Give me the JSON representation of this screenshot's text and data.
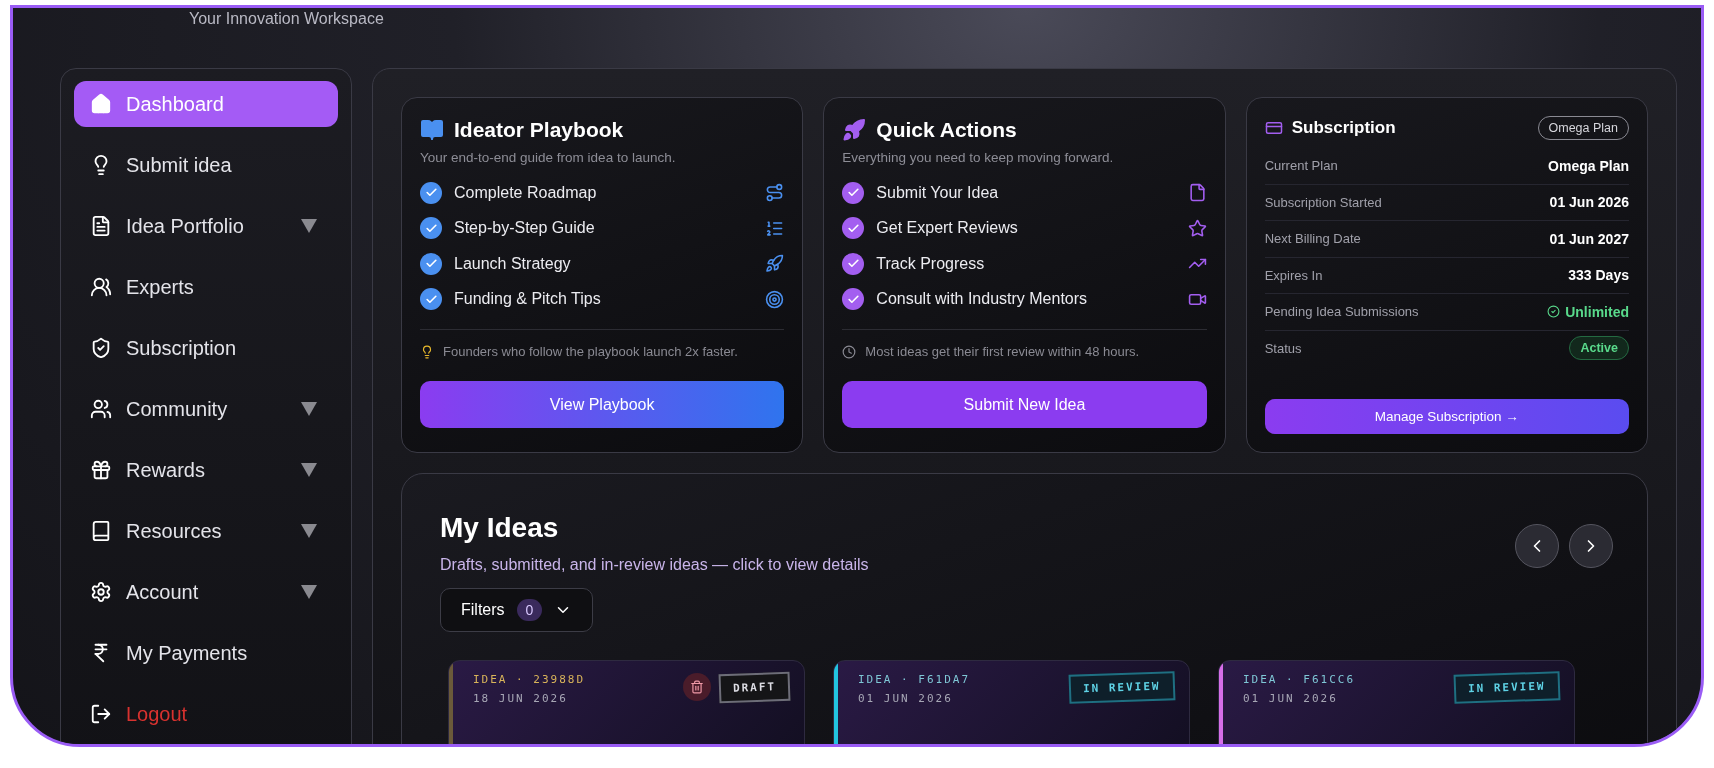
{
  "header": {
    "tagline": "Your Innovation Workspace"
  },
  "sidebar": {
    "items": [
      {
        "label": "Dashboard",
        "selected": true,
        "has_submenu": false,
        "kind": "normal"
      },
      {
        "label": "Submit idea",
        "selected": false,
        "has_submenu": false,
        "kind": "normal"
      },
      {
        "label": "Idea Portfolio",
        "selected": false,
        "has_submenu": true,
        "kind": "normal"
      },
      {
        "label": "Experts",
        "selected": false,
        "has_submenu": false,
        "kind": "normal"
      },
      {
        "label": "Subscription",
        "selected": false,
        "has_submenu": false,
        "kind": "normal"
      },
      {
        "label": "Community",
        "selected": false,
        "has_submenu": true,
        "kind": "normal"
      },
      {
        "label": "Rewards",
        "selected": false,
        "has_submenu": true,
        "kind": "normal"
      },
      {
        "label": "Resources",
        "selected": false,
        "has_submenu": true,
        "kind": "normal"
      },
      {
        "label": "Account",
        "selected": false,
        "has_submenu": true,
        "kind": "normal"
      },
      {
        "label": "My Payments",
        "selected": false,
        "has_submenu": false,
        "kind": "normal"
      },
      {
        "label": "Logout",
        "selected": false,
        "has_submenu": false,
        "kind": "danger"
      }
    ]
  },
  "playbook": {
    "title": "Ideator Playbook",
    "subtitle": "Your end-to-end guide from idea to launch.",
    "items": [
      {
        "label": "Complete Roadmap",
        "checked": true
      },
      {
        "label": "Step-by-Step Guide",
        "checked": true
      },
      {
        "label": "Launch Strategy",
        "checked": true
      },
      {
        "label": "Funding & Pitch Tips",
        "checked": true
      }
    ],
    "note": "Founders who follow the playbook launch 2x faster.",
    "button": "View Playbook"
  },
  "quick_actions": {
    "title": "Quick Actions",
    "subtitle": "Everything you need to keep moving forward.",
    "items": [
      {
        "label": "Submit Your Idea",
        "checked": true
      },
      {
        "label": "Get Expert Reviews",
        "checked": true
      },
      {
        "label": "Track Progress",
        "checked": true
      },
      {
        "label": "Consult with Industry Mentors",
        "checked": true
      }
    ],
    "note": "Most ideas get their first review within 48 hours.",
    "button": "Submit New Idea"
  },
  "subscription": {
    "title": "Subscription",
    "plan_badge": "Omega Plan",
    "rows": [
      {
        "label": "Current Plan",
        "value": "Omega Plan",
        "kind": "text"
      },
      {
        "label": "Subscription Started",
        "value": "01 Jun 2026",
        "kind": "text"
      },
      {
        "label": "Next Billing Date",
        "value": "01 Jun 2027",
        "kind": "text"
      },
      {
        "label": "Expires In",
        "value": "333 Days",
        "kind": "text"
      },
      {
        "label": "Pending Idea Submissions",
        "value": "Unlimited",
        "kind": "positive"
      },
      {
        "label": "Status",
        "value": "Active",
        "kind": "badge"
      }
    ],
    "button": "Manage Subscription →"
  },
  "my_ideas": {
    "title": "My Ideas",
    "subtitle": "Drafts, submitted, and in-review ideas — click to view details",
    "filters": {
      "label": "Filters",
      "count": "0"
    },
    "cards": [
      {
        "id": "IDEA · 23988D",
        "date": "18 JUN 2026",
        "status": "DRAFT",
        "kind": "draft",
        "color": "#6b5a3a"
      },
      {
        "id": "IDEA · F61DA7",
        "date": "01 JUN 2026",
        "status": "IN REVIEW",
        "kind": "review",
        "color": "#22c5e0"
      },
      {
        "id": "IDEA · F61CC6",
        "date": "01 JUN 2026",
        "status": "IN REVIEW",
        "kind": "review",
        "color": "#d66ee8"
      }
    ]
  }
}
